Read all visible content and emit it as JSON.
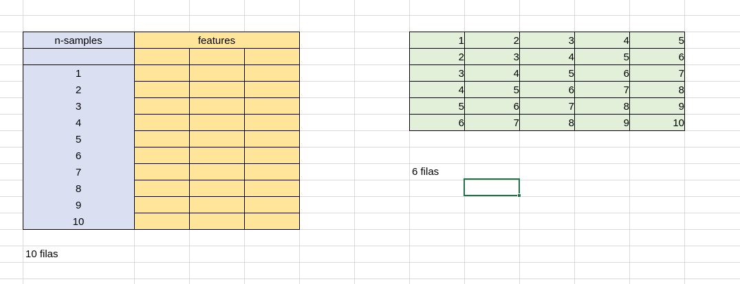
{
  "left_table": {
    "header_rows": "n-samples",
    "header_features": "features",
    "rows": [
      "1",
      "2",
      "3",
      "4",
      "5",
      "6",
      "7",
      "8",
      "9",
      "10"
    ],
    "fill_colors": {
      "rows": "#dae0f2",
      "features": "#ffe59a"
    }
  },
  "left_note": "10 filas",
  "right_table": {
    "rows": [
      [
        "1",
        "2",
        "3",
        "4",
        "5"
      ],
      [
        "2",
        "3",
        "4",
        "5",
        "6"
      ],
      [
        "3",
        "4",
        "5",
        "6",
        "7"
      ],
      [
        "4",
        "5",
        "6",
        "7",
        "8"
      ],
      [
        "5",
        "6",
        "7",
        "8",
        "9"
      ],
      [
        "6",
        "7",
        "8",
        "9",
        "10"
      ]
    ],
    "fill_color": "#e2efd9"
  },
  "right_note": "6 filas",
  "accent": "#217346"
}
